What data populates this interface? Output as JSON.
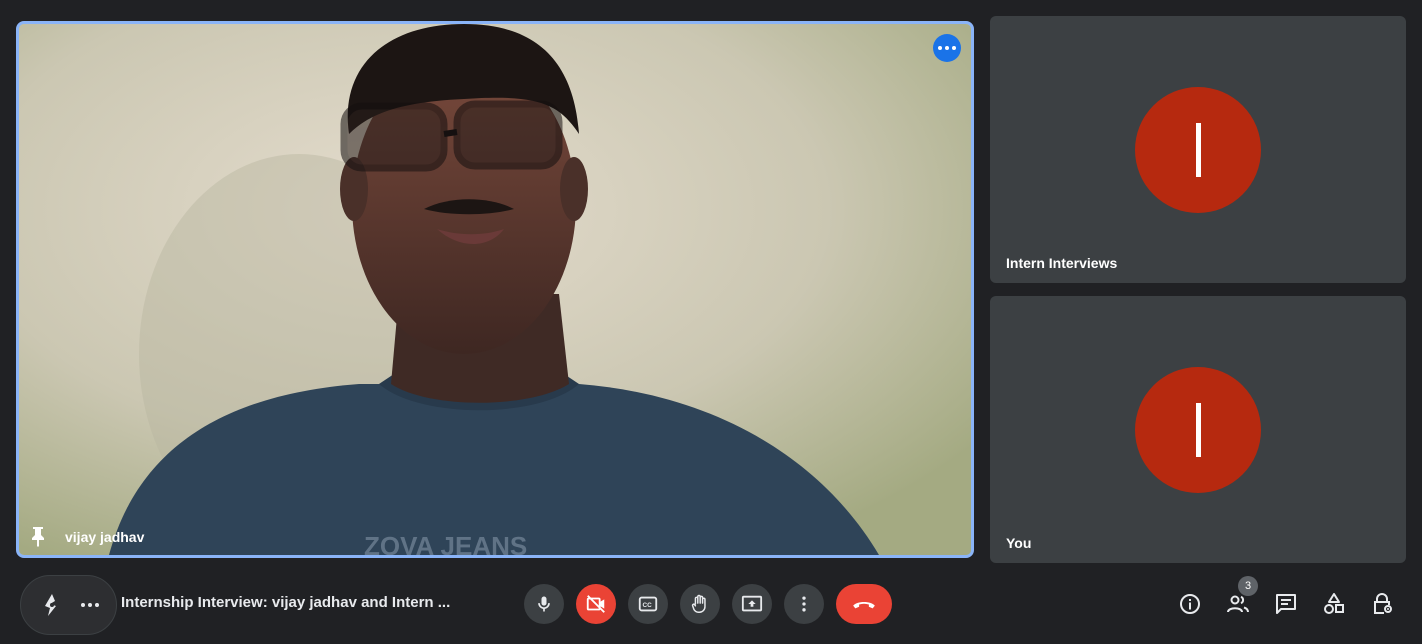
{
  "main_tile": {
    "participant_name": "vijay jadhav",
    "shirt_text": "ZOVA JEANS",
    "highlight_color": "#8ab4f8",
    "menu_icon": "more-horiz-icon",
    "pin_icon": "pin-icon"
  },
  "side_tiles": [
    {
      "name": "Intern Interviews",
      "avatar_letter": "I",
      "avatar_color": "#b6290f"
    },
    {
      "name": "You",
      "avatar_letter": "I",
      "avatar_color": "#b6290f"
    }
  ],
  "bottom_bar": {
    "meeting_title": "Internship Interview: vijay jadhav and Intern ...",
    "companion_icons": [
      "activities-sparkle-icon",
      "more-horiz-icon"
    ],
    "controls": [
      {
        "name": "microphone-button",
        "icon": "mic-icon",
        "state": "on"
      },
      {
        "name": "camera-button",
        "icon": "videocam-off-icon",
        "state": "off"
      },
      {
        "name": "captions-button",
        "icon": "closed-caption-icon"
      },
      {
        "name": "raise-hand-button",
        "icon": "hand-icon"
      },
      {
        "name": "present-button",
        "icon": "present-screen-icon"
      },
      {
        "name": "more-options-button",
        "icon": "more-vert-icon"
      },
      {
        "name": "leave-call-button",
        "icon": "call-end-icon"
      }
    ],
    "right_icons": [
      {
        "name": "meeting-details-button",
        "icon": "info-icon"
      },
      {
        "name": "people-button",
        "icon": "people-icon",
        "badge": "3"
      },
      {
        "name": "chat-button",
        "icon": "chat-icon"
      },
      {
        "name": "activities-button",
        "icon": "shapes-icon"
      },
      {
        "name": "host-controls-button",
        "icon": "lock-person-icon"
      }
    ]
  },
  "colors": {
    "background": "#202124",
    "tile": "#3c4043",
    "danger": "#ea4335",
    "accent": "#1a73e8"
  }
}
